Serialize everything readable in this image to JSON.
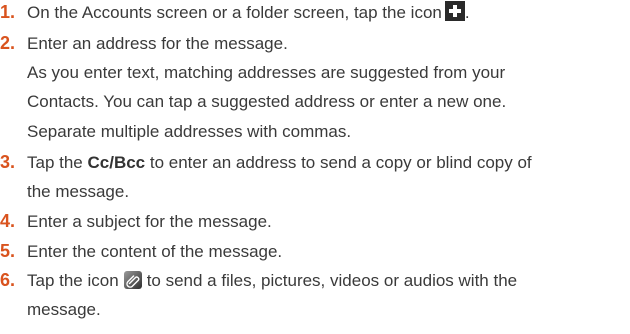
{
  "steps": [
    {
      "number": "1.",
      "text_before": "On the Accounts screen or a folder screen, tap the icon",
      "icon": "plus-icon",
      "text_after": "."
    },
    {
      "number": "2.",
      "text": "Enter an address for the message.",
      "details": [
        "As you enter text, matching addresses are suggested from your",
        "Contacts. You can tap a suggested address or enter a new one.",
        "Separate multiple addresses with commas."
      ]
    },
    {
      "number": "3.",
      "text_before": "Tap the ",
      "bold": "Cc/Bcc",
      "text_after": " to enter an address to send a copy or blind copy of",
      "continuation": "the message."
    },
    {
      "number": "4.",
      "text": "Enter a subject for the message."
    },
    {
      "number": "5.",
      "text": "Enter the content of the message."
    },
    {
      "number": "6.",
      "text_before": "Tap the icon",
      "icon": "paperclip-icon",
      "text_after": "to send a files, pictures, videos or audios with the",
      "continuation": "message."
    }
  ],
  "colors": {
    "number": "#d9531e",
    "text": "#3a3a3a",
    "icon_dark": "#2a2a2a"
  }
}
